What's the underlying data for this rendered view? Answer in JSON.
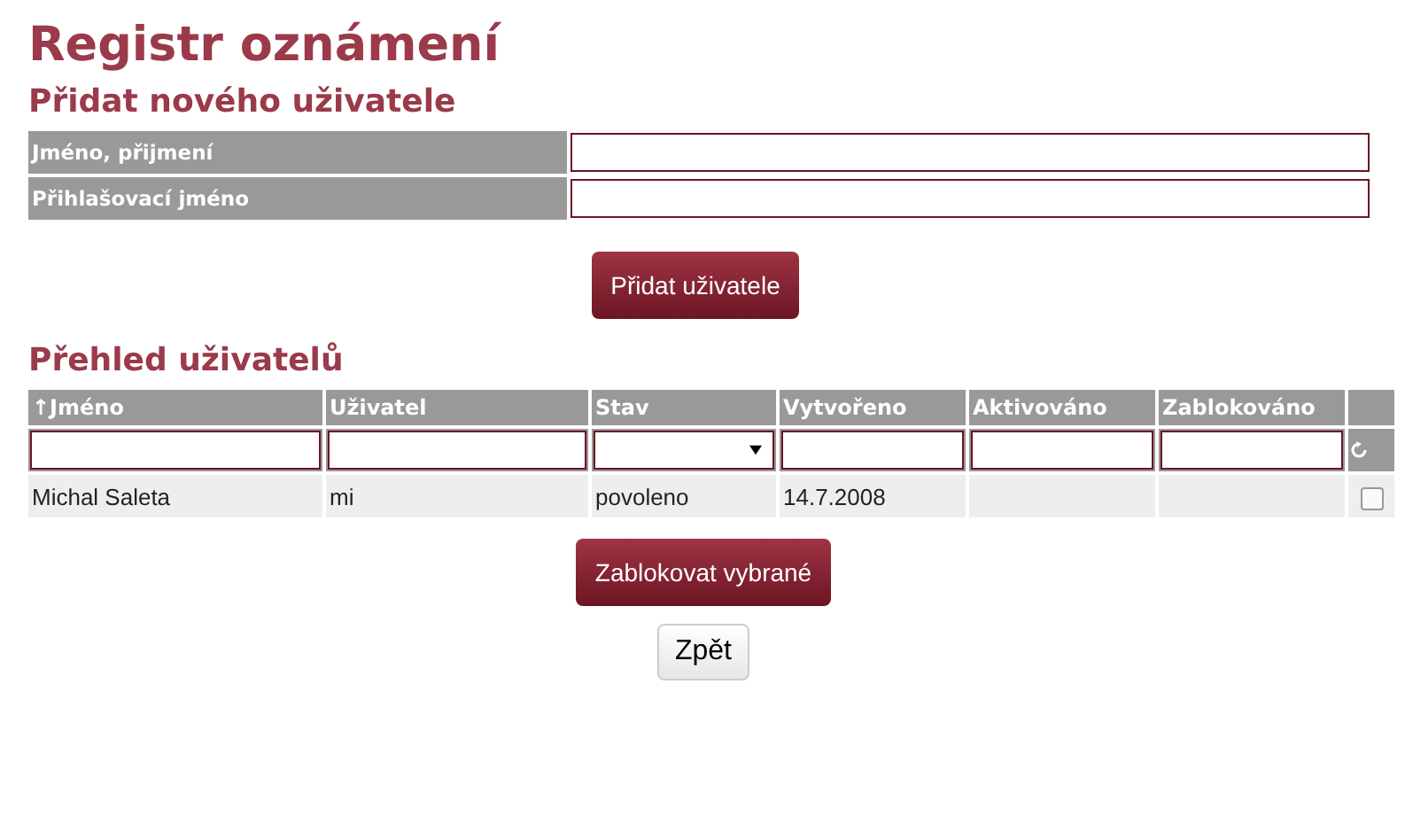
{
  "title": "Registr oznámení",
  "add_user": {
    "heading": "Přidat nového uživatele",
    "fields": [
      {
        "label": "Jméno, přijmení"
      },
      {
        "label": "Přihlašovací jméno"
      }
    ],
    "submit": "Přidat uživatele"
  },
  "overview": {
    "heading": "Přehled uživatelů",
    "columns": [
      "↑Jméno",
      "Uživatel",
      "Stav",
      "Vytvořeno",
      "Aktivováno",
      "Zablokováno"
    ],
    "filters": [
      {
        "kind": "text"
      },
      {
        "kind": "text"
      },
      {
        "kind": "select"
      },
      {
        "kind": "text"
      },
      {
        "kind": "text"
      },
      {
        "kind": "text"
      }
    ],
    "rows": [
      {
        "cells": [
          "Michal Saleta",
          "mi",
          "povoleno",
          "14.7.2008",
          "",
          ""
        ],
        "checked": false
      }
    ],
    "block_button": "Zablokovat vybrané"
  },
  "back_button": "Zpět"
}
